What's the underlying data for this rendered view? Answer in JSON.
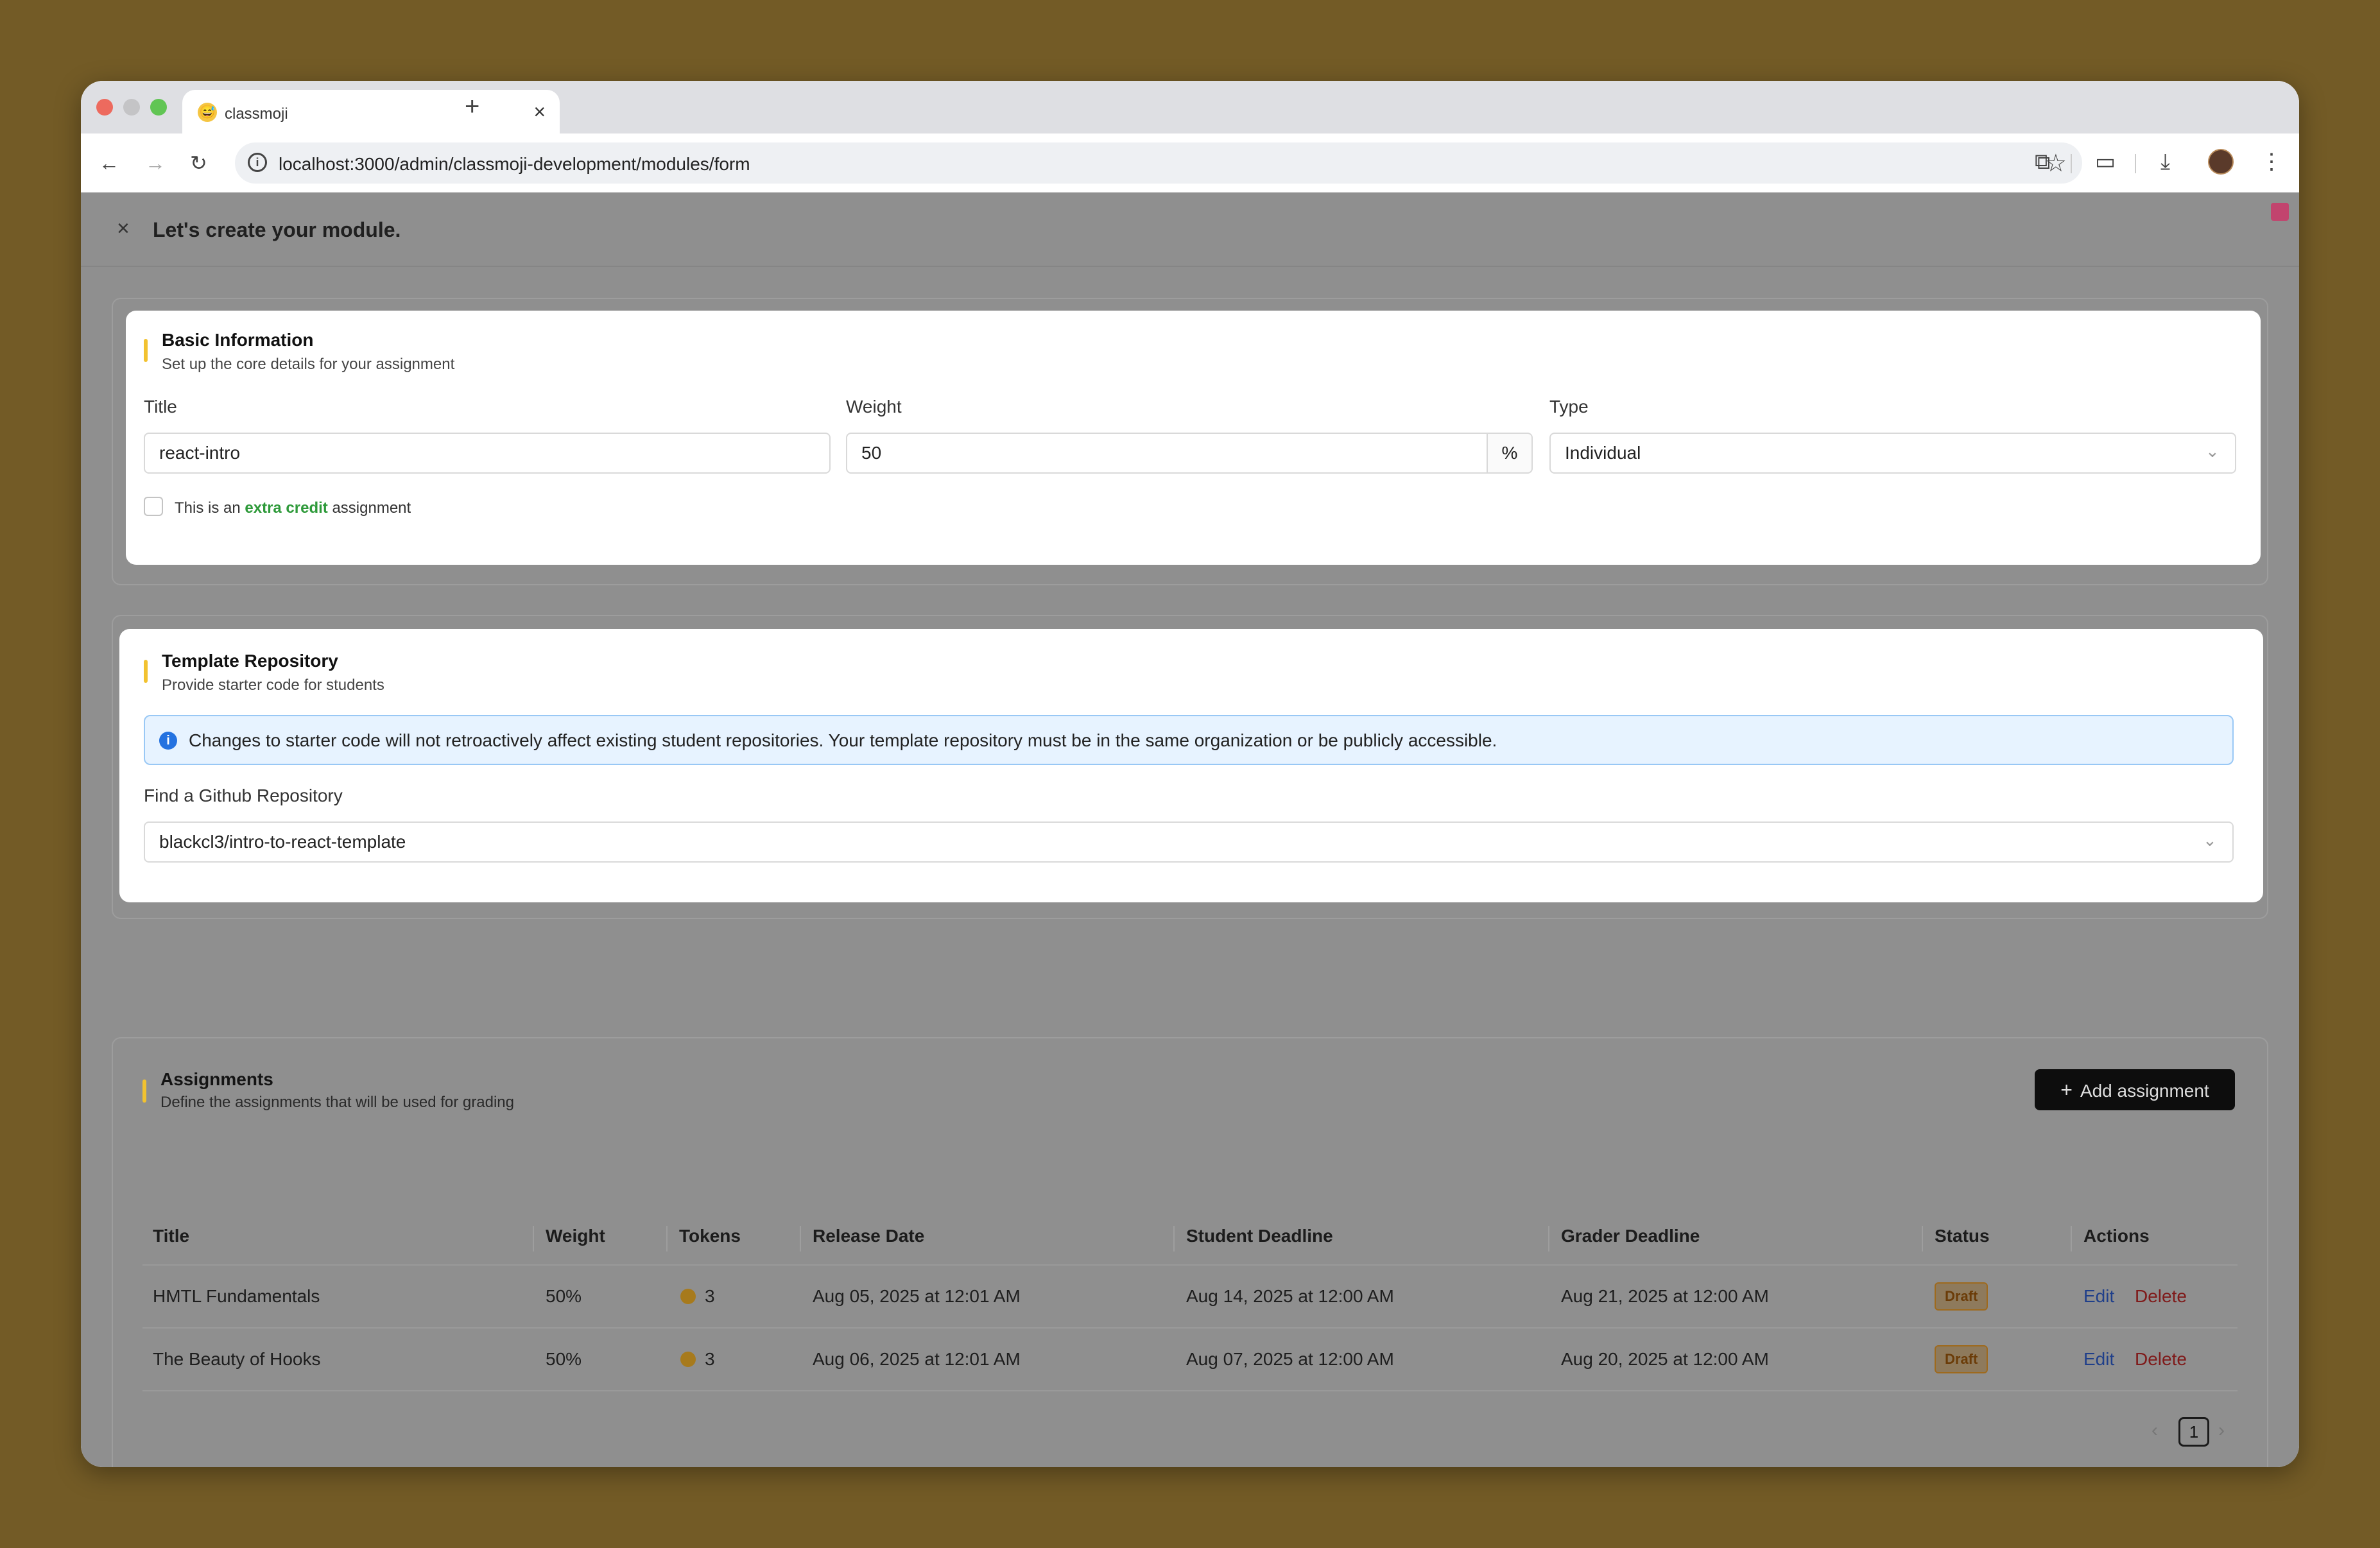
{
  "browser": {
    "tab_title": "classmoji",
    "tab_favicon": "😅",
    "url": "localhost:3000/admin/classmoji-development/modules/form"
  },
  "page": {
    "title": "Let's create your module."
  },
  "basic_info": {
    "title": "Basic Information",
    "subtitle": "Set up the core details for your assignment",
    "title_label": "Title",
    "title_value": "react-intro",
    "weight_label": "Weight",
    "weight_value": "50",
    "weight_suffix": "%",
    "type_label": "Type",
    "type_value": "Individual",
    "extra_credit_prefix": "This is an",
    "extra_credit_highlight": "extra credit",
    "extra_credit_suffix": "assignment"
  },
  "template_repo": {
    "title": "Template Repository",
    "subtitle": "Provide starter code for students",
    "alert_text": "Changes to starter code will not retroactively affect existing student repositories. Your template repository must be in the same organization or be publicly accessible.",
    "find_label": "Find a Github Repository",
    "repo_value": "blackcl3/intro-to-react-template"
  },
  "assignments": {
    "title": "Assignments",
    "subtitle": "Define the assignments that will be used for grading",
    "add_button": "Add assignment",
    "columns": [
      "Title",
      "Weight",
      "Tokens",
      "Release Date",
      "Student Deadline",
      "Grader Deadline",
      "Status",
      "Actions"
    ],
    "rows": [
      {
        "title": "HMTL Fundamentals",
        "weight": "50%",
        "tokens": "3",
        "release": "Aug 05, 2025 at 12:01 AM",
        "student_deadline": "Aug 14, 2025 at 12:00 AM",
        "grader_deadline": "Aug 21, 2025 at 12:00 AM",
        "status": "Draft",
        "edit": "Edit",
        "delete": "Delete"
      },
      {
        "title": "The Beauty of Hooks",
        "weight": "50%",
        "tokens": "3",
        "release": "Aug 06, 2025 at 12:01 AM",
        "student_deadline": "Aug 07, 2025 at 12:00 AM",
        "grader_deadline": "Aug 20, 2025 at 12:00 AM",
        "status": "Draft",
        "edit": "Edit",
        "delete": "Delete"
      }
    ],
    "current_page": "1"
  },
  "icons": {
    "close": "close-icon",
    "info": "info-icon",
    "chevron": "chevron-down-icon",
    "plus": "plus-icon",
    "token": "token-coin-icon"
  },
  "colors": {
    "accent_bar": "#f2c230",
    "extra_credit": "#2e9a3a",
    "add_button_bg": "#0d0d0d",
    "info_blue": "#2472e0",
    "backdrop": "#735b26"
  }
}
